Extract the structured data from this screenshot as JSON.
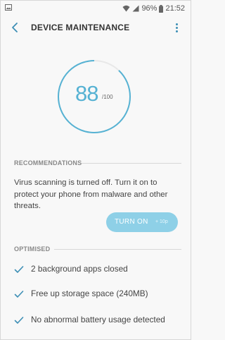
{
  "status_bar": {
    "battery": "96%",
    "time": "21:52",
    "icons": [
      "gallery-notification-icon",
      "wifi-icon",
      "signal-icon",
      "battery-icon"
    ]
  },
  "header": {
    "title": "DEVICE MAINTENANCE",
    "back_icon": "chevron-left-icon",
    "more_icon": "more-vert-icon"
  },
  "score": {
    "value": "88",
    "max": "/100",
    "fraction": 0.88,
    "color": "#56b2d3"
  },
  "recommendations": {
    "heading": "RECOMMENDATIONS",
    "text": "Virus scanning is turned off. Turn it on to protect your phone from malware and other threats.",
    "button_label": "TURN ON",
    "button_points": "+ 10p",
    "button_color": "#8ed0e7"
  },
  "optimised": {
    "heading": "OPTIMISED",
    "items": [
      "2 background apps closed",
      "Free up storage space (240MB)",
      "No abnormal battery usage detected"
    ],
    "check_icon": "check-icon",
    "accent": "#3d8fb5"
  }
}
